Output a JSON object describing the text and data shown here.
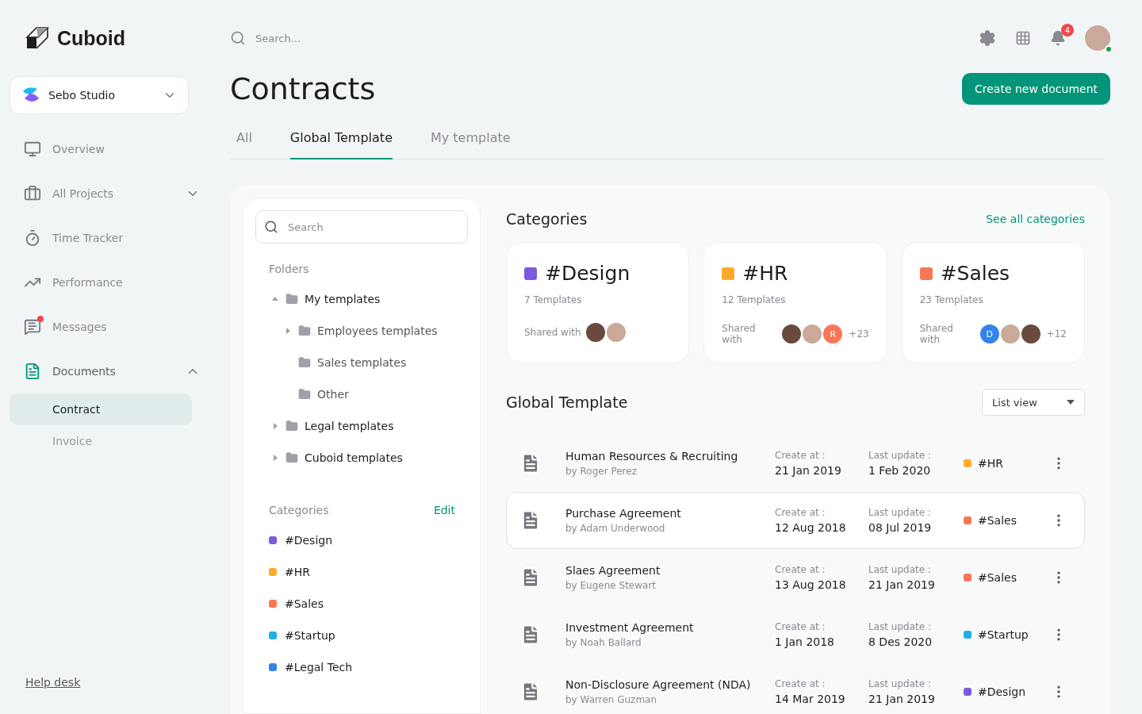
{
  "brand": "Cuboid",
  "workspace": {
    "name": "Sebo Studio"
  },
  "nav": [
    {
      "label": "Overview",
      "selected": false
    },
    {
      "label": "All Projects",
      "selected": false,
      "expanded": false
    },
    {
      "label": "Time Tracker",
      "selected": false
    },
    {
      "label": "Performance",
      "selected": false
    },
    {
      "label": "Messages",
      "selected": false,
      "unread": true
    },
    {
      "label": "Documents",
      "selected": true,
      "expanded": true,
      "children": [
        {
          "label": "Contract",
          "selected": true
        },
        {
          "label": "Invoice",
          "selected": false
        }
      ]
    }
  ],
  "help_link": "Help desk",
  "header": {
    "search": {
      "placeholder": "Search..."
    },
    "notifications": "4",
    "online": true
  },
  "page_title": "Contracts",
  "create_button": "Create new document",
  "tabs": [
    {
      "label": "All",
      "selected": false
    },
    {
      "label": "Global Template",
      "selected": true
    },
    {
      "label": "My template",
      "selected": false
    }
  ],
  "folder_panel": {
    "search": {
      "placeholder": "Search"
    },
    "folders_heading": "Folders",
    "folders": [
      {
        "label": "My templates",
        "expanded": true,
        "children": [
          {
            "label": "Employees templates",
            "expanded": false
          },
          {
            "label": "Sales templates"
          },
          {
            "label": "Other"
          }
        ]
      },
      {
        "label": "Legal templates",
        "expanded": false
      },
      {
        "label": "Cuboid templates",
        "expanded": false
      }
    ],
    "categories_heading": "Categories",
    "edit_link": "Edit",
    "categories": [
      {
        "label": "#Design",
        "color": "#7b5ae0"
      },
      {
        "label": "#HR",
        "color": "#ffaa2b"
      },
      {
        "label": "#Sales",
        "color": "#fa7554"
      },
      {
        "label": "#Startup",
        "color": "#1fb0e3"
      },
      {
        "label": "#Legal Tech",
        "color": "#3283ea"
      }
    ]
  },
  "categories_section": {
    "title": "Categories",
    "link": "See all categories",
    "cards": [
      {
        "name": "#Design",
        "color": "#7b5ae0",
        "count": "7 Templates",
        "shared_label": "Shared with",
        "avatars": [
          {
            "kind": "photo"
          },
          {
            "kind": "photo"
          }
        ]
      },
      {
        "name": "#HR",
        "color": "#ffaa2b",
        "count": "12 Templates",
        "shared_label": "Shared with",
        "avatars": [
          {
            "kind": "photo"
          },
          {
            "kind": "photo"
          },
          {
            "kind": "initial",
            "letter": "R",
            "color": "#fa7554"
          }
        ],
        "more": "+23"
      },
      {
        "name": "#Sales",
        "color": "#fa7554",
        "count": "23 Templates",
        "shared_label": "Shared with",
        "avatars": [
          {
            "kind": "initial",
            "letter": "D",
            "color": "#3283ea"
          },
          {
            "kind": "photo"
          },
          {
            "kind": "photo"
          }
        ],
        "more": "+12"
      }
    ]
  },
  "documents": {
    "title": "Global Template",
    "view": "List view",
    "rows": [
      {
        "title": "Human Resources & Recruiting",
        "author": "by Roger Perez",
        "created_label": "Create at :",
        "created": "21 Jan 2019",
        "updated_label": "Last update :",
        "updated": "1 Feb 2020",
        "tag": "#HR",
        "color": "#ffaa2b",
        "selected": false
      },
      {
        "title": "Purchase Agreement",
        "author": "by Adam Underwood",
        "created_label": "Create at :",
        "created": "12 Aug 2018",
        "updated_label": "Last update :",
        "updated": "08 Jul 2019",
        "tag": "#Sales",
        "color": "#fa7554",
        "selected": true
      },
      {
        "title": "Slaes Agreement",
        "author": "by Eugene Stewart",
        "created_label": "Create at :",
        "created": "13 Aug 2018",
        "updated_label": "Last update :",
        "updated": "21 Jan 2019",
        "tag": "#Sales",
        "color": "#fa7554",
        "selected": false
      },
      {
        "title": "Investment Agreement",
        "author": "by Noah Ballard",
        "created_label": "Create at :",
        "created": "1 Jan 2018",
        "updated_label": "Last update :",
        "updated": "8 Des 2020",
        "tag": "#Startup",
        "color": "#1fb0e3",
        "selected": false
      },
      {
        "title": "Non-Disclosure Agreement (NDA)",
        "author": "by Warren Guzman",
        "created_label": "Create at :",
        "created": "14 Mar 2019",
        "updated_label": "Last update :",
        "updated": "21 Jan 2019",
        "tag": "#Design",
        "color": "#7b5ae0",
        "selected": false
      }
    ]
  }
}
